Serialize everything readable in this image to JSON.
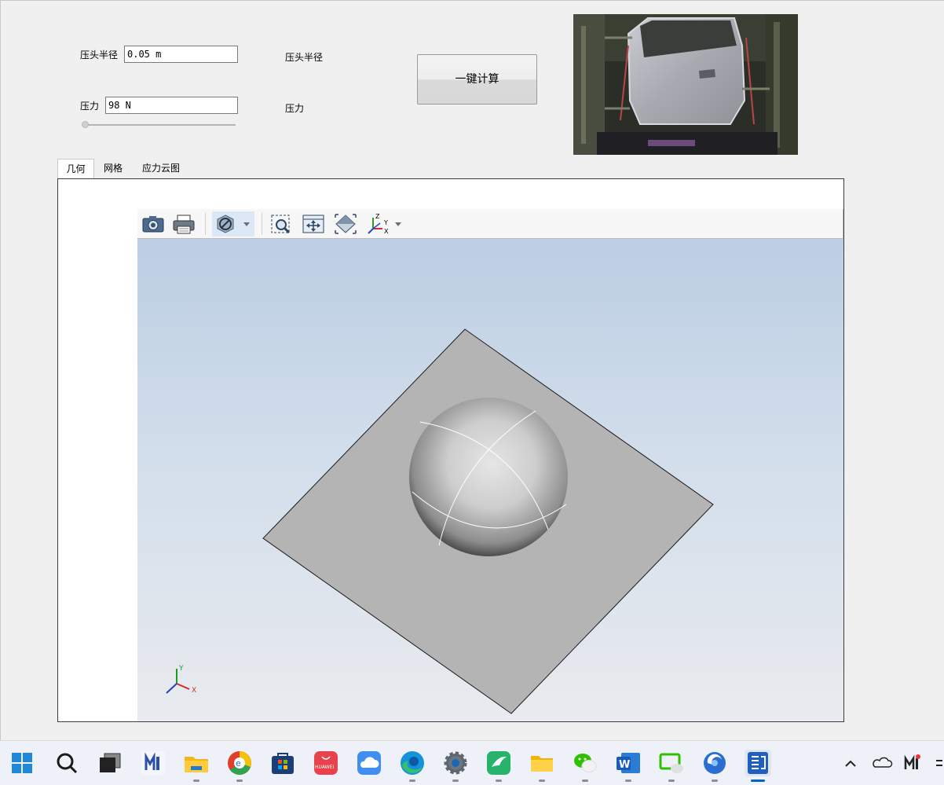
{
  "params": {
    "radius_label": "压头半径",
    "radius_value": "0.05 m",
    "radius_display": "压头半径",
    "force_label": "压力",
    "force_value": "98 N",
    "force_display": "压力",
    "force_slider_position": 0
  },
  "calc_button_label": "一键计算",
  "photo": {
    "subject": "car-door-on-fixture-photo"
  },
  "tabs": [
    {
      "label": "几何",
      "active": true
    },
    {
      "label": "网格",
      "active": false
    },
    {
      "label": "应力云图",
      "active": false
    }
  ],
  "viewer": {
    "toolbar": [
      "camera-icon",
      "print-icon",
      "display-mode-icon",
      "dropdown-arrow-icon",
      "zoom-box-icon",
      "fit-all-icon",
      "view-iso-icon",
      "axes-view-icon",
      "dropdown-arrow-icon"
    ],
    "scene": {
      "plate": "flat-square-plate",
      "indenter": "sphere",
      "background_top": "#bccee3",
      "background_bottom": "#e9ebef",
      "plate_color": "#b4b4b4"
    },
    "triad": {
      "x": "X",
      "y": "Y",
      "z": "Z"
    },
    "toolbar_axes": {
      "z": "Z",
      "y": "Y",
      "x": "X"
    }
  },
  "taskbar": {
    "apps": [
      "start-icon",
      "search-icon",
      "task-view-icon",
      "m-app-icon",
      "file-explorer-icon",
      "browser-e-icon",
      "store-icon",
      "huawei-appgallery-icon",
      "cloud-drive-icon",
      "edge-icon",
      "settings-icon",
      "pdf-swift-icon",
      "folder-icon",
      "wechat-icon",
      "word-icon",
      "screen-share-icon",
      "xiaomi-icon",
      "app-window-icon"
    ],
    "huawei_text": "HUAWEI",
    "word_letter": "W",
    "tray": [
      "chevron-up-icon",
      "onedrive-icon",
      "m-tray-icon",
      "network-icon"
    ]
  }
}
